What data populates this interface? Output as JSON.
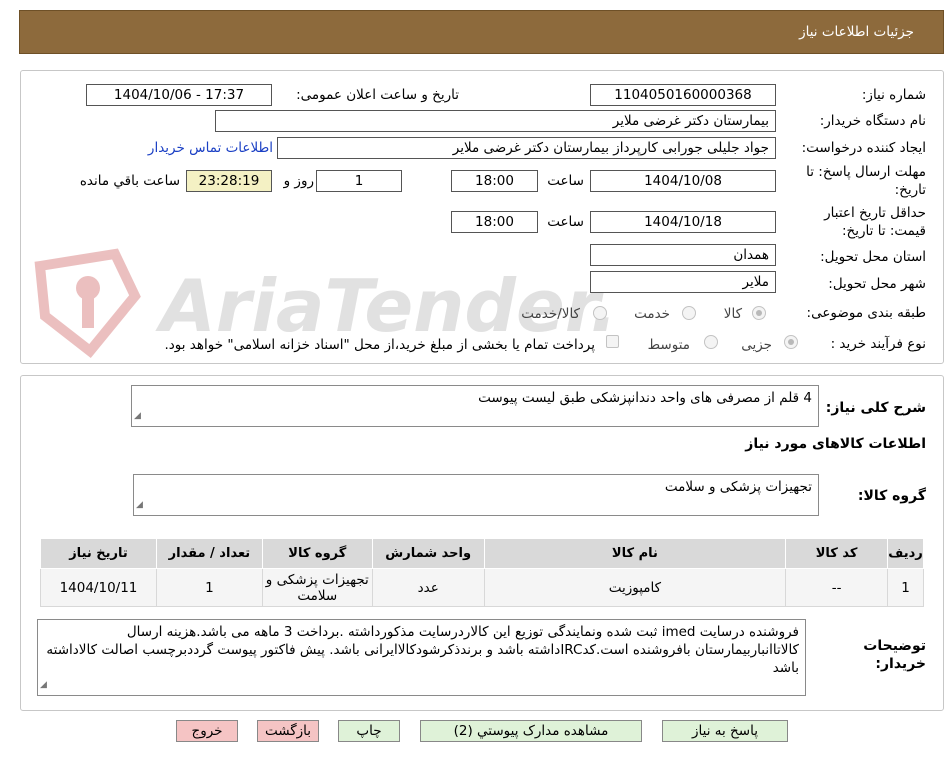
{
  "header": {
    "title": "جزئیات اطلاعات نیاز"
  },
  "fields": {
    "need_number": {
      "label": "شماره نیاز:",
      "value": "1104050160000368"
    },
    "announce": {
      "label": "تاریخ و ساعت اعلان عمومی:",
      "value": "1404/10/06 - 17:37"
    },
    "buyer": {
      "label": "نام دستگاه خریدار:",
      "value": "بیمارستان دکتر غرضی ملایر"
    },
    "requester": {
      "label": "ایجاد کننده درخواست:",
      "value": "جواد جلیلی جورابی کارپرداز بیمارستان دکتر غرضی ملایر",
      "contact_link": "اطلاعات تماس خریدار"
    },
    "deadline": {
      "label_line1": "مهلت ارسال پاسخ: تا",
      "label_line2": "تاریخ:",
      "date": "1404/10/08",
      "time_label": "ساعت",
      "time": "18:00",
      "days": "1",
      "days_label": "روز و",
      "remaining": "23:28:19",
      "remaining_label": "ساعت باقي مانده"
    },
    "validity": {
      "label_line1": "حداقل تاریخ اعتبار",
      "label_line2": "قیمت: تا تاریخ:",
      "date": "1404/10/18",
      "time_label": "ساعت",
      "time": "18:00"
    },
    "province": {
      "label": "استان محل تحویل:",
      "value": "همدان"
    },
    "city": {
      "label": "شهر محل تحویل:",
      "value": "ملایر"
    },
    "category": {
      "label": "طبقه بندی موضوعی:",
      "options": [
        "کالا",
        "خدمت",
        "کالا/خدمت"
      ]
    },
    "process": {
      "label": "نوع فرآیند خرید :",
      "options": [
        "جزیی",
        "متوسط"
      ],
      "note": "پرداخت تمام یا بخشی از مبلغ خرید،از محل \"اسناد خزانه اسلامی\" خواهد بود."
    }
  },
  "summary": {
    "label": "شرح کلی نیاز:",
    "value": "4 قلم از مصرفی های واحد دندانپزشکی طبق لیست پیوست"
  },
  "goods_info": {
    "heading": "اطلاعات کالاهای مورد نیاز"
  },
  "goods_group": {
    "label": "گروه کالا:",
    "value": "تجهیزات پزشکی و سلامت"
  },
  "table": {
    "columns": [
      "ردیف",
      "کد کالا",
      "نام کالا",
      "واحد شمارش",
      "گروه کالا",
      "تعداد / مقدار",
      "تاریخ نیاز"
    ],
    "rows": [
      {
        "row": "1",
        "code": "--",
        "name": "کامپوزیت",
        "unit": "عدد",
        "group": "تجهیزات پزشکی و سلامت",
        "qty": "1",
        "date": "1404/10/11"
      }
    ]
  },
  "notes": {
    "label_line1": "توضیحات",
    "label_line2": "خریدار:",
    "value": "فروشنده درسایت imed ثبت شده ونمایندگی توزیع این کالاردرسایت مذکورداشته .برداخت 3 ماهه می باشد.هزینه ارسال کالاتاانباربیمارستان بافروشنده است.کدIRCداشته باشد و برندذکرشودکالاایرانی باشد. پیش فاکتور پیوست گرددبرچسب اصالت کالاداشته باشد"
  },
  "buttons": {
    "reply": "پاسخ به نیاز",
    "attachments": "مشاهده مدارک پیوستي (2)",
    "print": "چاپ",
    "back": "بازگشت",
    "exit": "خروج"
  },
  "watermark": {
    "text": "AriaTender.net"
  },
  "colors": {
    "header_bg": "#8d6a3c",
    "link": "#1a3fc4",
    "remaining_bg": "#f4f1c4",
    "button_green": "#dff2d8",
    "button_pink": "#f5c4c4"
  }
}
